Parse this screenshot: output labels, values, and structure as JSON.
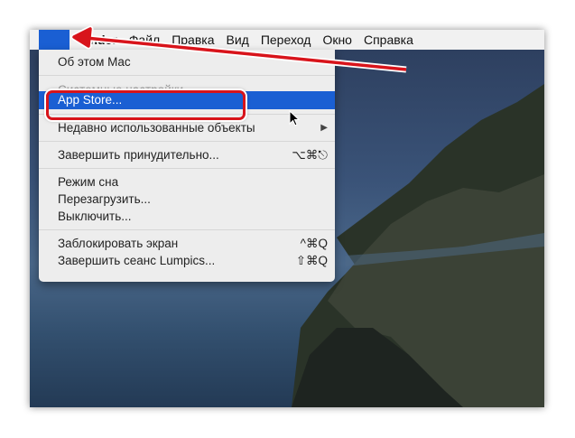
{
  "menubar": {
    "apple_icon": "apple-logo-icon",
    "items": [
      "Finder",
      "Файл",
      "Правка",
      "Вид",
      "Переход",
      "Окно",
      "Справка"
    ]
  },
  "apple_menu": {
    "about": "Об этом Mac",
    "system_prefs": "Системные настройки...",
    "app_store": "App Store...",
    "recent": "Недавно использованные объекты",
    "force_quit": "Завершить принудительно...",
    "force_quit_shortcut": "⌥⌘⎋",
    "sleep": "Режим сна",
    "restart": "Перезагрузить...",
    "shutdown": "Выключить...",
    "lock": "Заблокировать экран",
    "lock_shortcut": "^⌘Q",
    "logout": "Завершить сеанс Lumpics...",
    "logout_shortcut": "⇧⌘Q"
  },
  "colors": {
    "highlight": "#1a5fd3",
    "annotation": "#d8141b"
  }
}
